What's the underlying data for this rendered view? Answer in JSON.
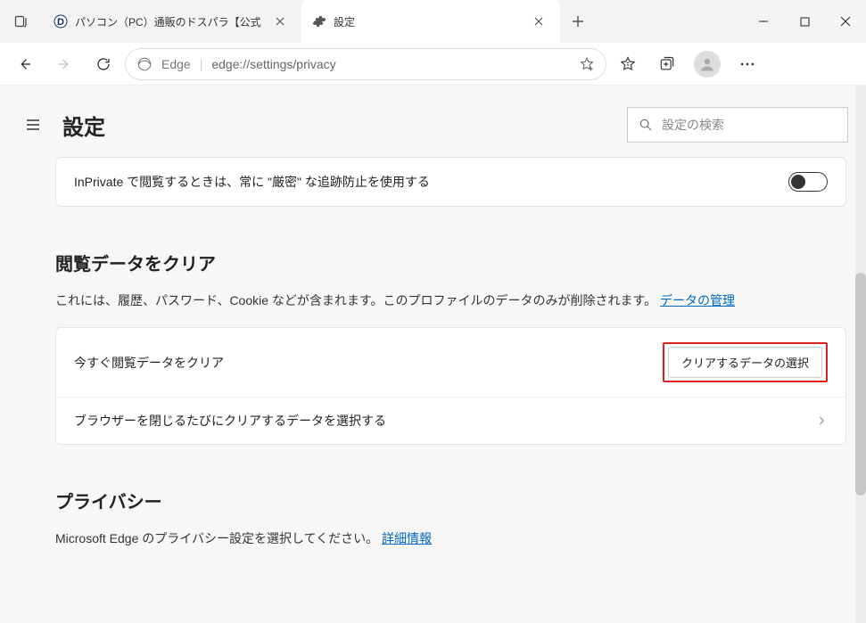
{
  "tabs": [
    {
      "title": "パソコン（PC）通販のドスパラ【公式"
    },
    {
      "title": "設定"
    }
  ],
  "toolbar": {
    "edge_label": "Edge",
    "url": "edge://settings/privacy"
  },
  "page": {
    "title": "設定",
    "search_placeholder": "設定の検索"
  },
  "inprivate_row": {
    "label": "InPrivate で閲覧するときは、常に \"厳密\" な追跡防止を使用する"
  },
  "clear_browsing": {
    "heading": "閲覧データをクリア",
    "description_pre": "これには、履歴、パスワード、Cookie などが含まれます。このプロファイルのデータのみが削除されます。",
    "description_link": "データの管理",
    "clear_now_label": "今すぐ閲覧データをクリア",
    "choose_button": "クリアするデータの選択",
    "on_close_label": "ブラウザーを閉じるたびにクリアするデータを選択する"
  },
  "privacy": {
    "heading": "プライバシー",
    "description_pre": "Microsoft Edge のプライバシー設定を選択してください。",
    "description_link": "詳細情報"
  }
}
